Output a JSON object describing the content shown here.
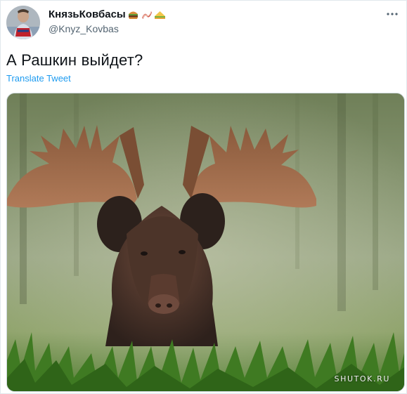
{
  "tweet": {
    "display_name": "КнязьКовбасы",
    "name_emojis": [
      "hamburger-emoji",
      "bacon-emoji",
      "sandwich-emoji"
    ],
    "handle": "@Knyz_Kovbas",
    "text": "А Рашкин выйдет?",
    "translate_label": "Translate Tweet",
    "more_icon": "more-horizontal-icon"
  },
  "media": {
    "description_icon": "photo",
    "watermark": "SHUTOK.RU"
  },
  "colors": {
    "link": "#1d9bf0",
    "text": "#0f1419",
    "secondary": "#536471"
  }
}
